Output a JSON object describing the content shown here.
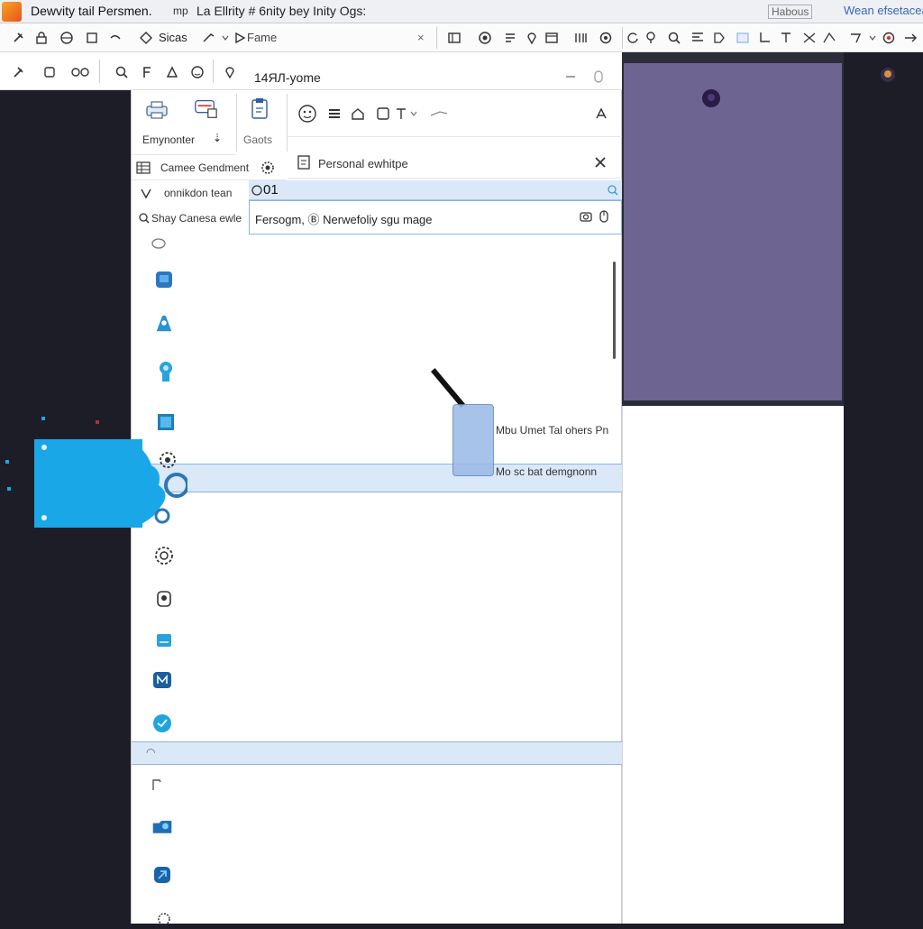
{
  "window": {
    "title": "Dewvity tail Persmen.",
    "title_fragment": "mp",
    "subtitle": "La Ellrity # 6nity bey Inity Ogs:",
    "right_button": "Habous",
    "right_link": "Wean efsetacea"
  },
  "toolbar": {
    "sicas_label": "Sicas",
    "name_label": "Fame",
    "close_glyph": "×"
  },
  "address": {
    "value": "14ЯЛ-yome"
  },
  "ribbon": {
    "emynonter_label": "Emynonter",
    "goots_label": "Gaots",
    "camee_label": "Camee Gendment",
    "personal_label": "Personal ewhitpe",
    "onnikdon_label": "onnikdon tean",
    "shay_label": "Shay Canesa ewle",
    "query_value": "01",
    "search_value": "Fersogm, Ⓑ Nerwefoliy sgu mage"
  },
  "panel": {
    "card_caption_1": "Mbu Umet Tal ohers Pn",
    "card_caption_2": "Mo sc bat demgnonn"
  },
  "colors": {
    "accent": "#1aa7e8",
    "selection": "#dbe8f7",
    "dark_bg": "#1c1d27",
    "preview": "#6d6491"
  },
  "icons": {
    "list": [
      "chat-icon",
      "box-icon",
      "user-icon",
      "head-icon",
      "square-icon",
      "gear-icon",
      "settings-icon",
      "profile-icon",
      "doc-icon",
      "network-icon",
      "globe-icon",
      "bell-icon",
      "folder-icon",
      "tool-icon",
      "network-icon"
    ]
  }
}
